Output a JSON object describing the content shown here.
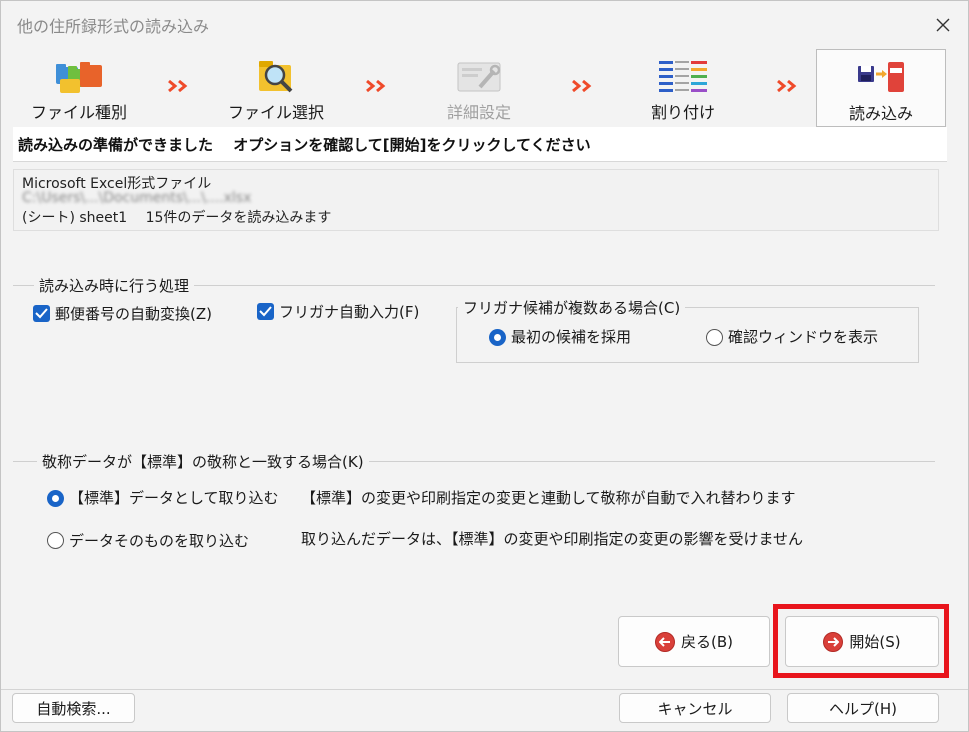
{
  "window": {
    "title": "他の住所録形式の読み込み"
  },
  "steps": [
    {
      "label": "ファイル種別",
      "icon": "folders-icon",
      "state": "done"
    },
    {
      "label": "ファイル選択",
      "icon": "folder-search-icon",
      "state": "done"
    },
    {
      "label": "詳細設定",
      "icon": "settings-tools-icon",
      "state": "disabled"
    },
    {
      "label": "割り付け",
      "icon": "field-mapping-icon",
      "state": "done"
    },
    {
      "label": "読み込み",
      "icon": "import-book-icon",
      "state": "active"
    }
  ],
  "header": {
    "message": "読み込みの準備ができました　 オプションを確認して[開始]をクリックしてください"
  },
  "info": {
    "format": "Microsoft Excel形式ファイル",
    "path": "C:\\Users\\...\\Documents\\...\\....xlsx",
    "summary": "(シート) sheet1　 15件のデータを読み込みます"
  },
  "processing": {
    "title": "読み込み時に行う処理",
    "postal_convert": {
      "label": "郵便番号の自動変換(Z)",
      "checked": true
    },
    "furigana_auto": {
      "label": "フリガナ自動入力(F)",
      "checked": true
    },
    "furigana_multi": {
      "title": "フリガナ候補が複数ある場合(C)",
      "options": [
        {
          "label": "最初の候補を採用",
          "selected": true
        },
        {
          "label": "確認ウィンドウを表示",
          "selected": false
        }
      ]
    }
  },
  "honorific": {
    "title": "敬称データが【標準】の敬称と一致する場合(K)",
    "options": [
      {
        "label": "【標準】データとして取り込む",
        "description": "【標準】の変更や印刷指定の変更と連動して敬称が自動で入れ替わります",
        "selected": true
      },
      {
        "label": "データそのものを取り込む",
        "description": "取り込んだデータは、【標準】の変更や印刷指定の変更の影響を受けません",
        "selected": false
      }
    ]
  },
  "buttons": {
    "back": "戻る(B)",
    "start": "開始(S)",
    "auto_search": "自動検索...",
    "cancel": "キャンセル",
    "help": "ヘルプ(H)"
  },
  "colors": {
    "accent": "#1964c7",
    "highlight": "#e8141c",
    "button_icon": "#d9403a"
  }
}
